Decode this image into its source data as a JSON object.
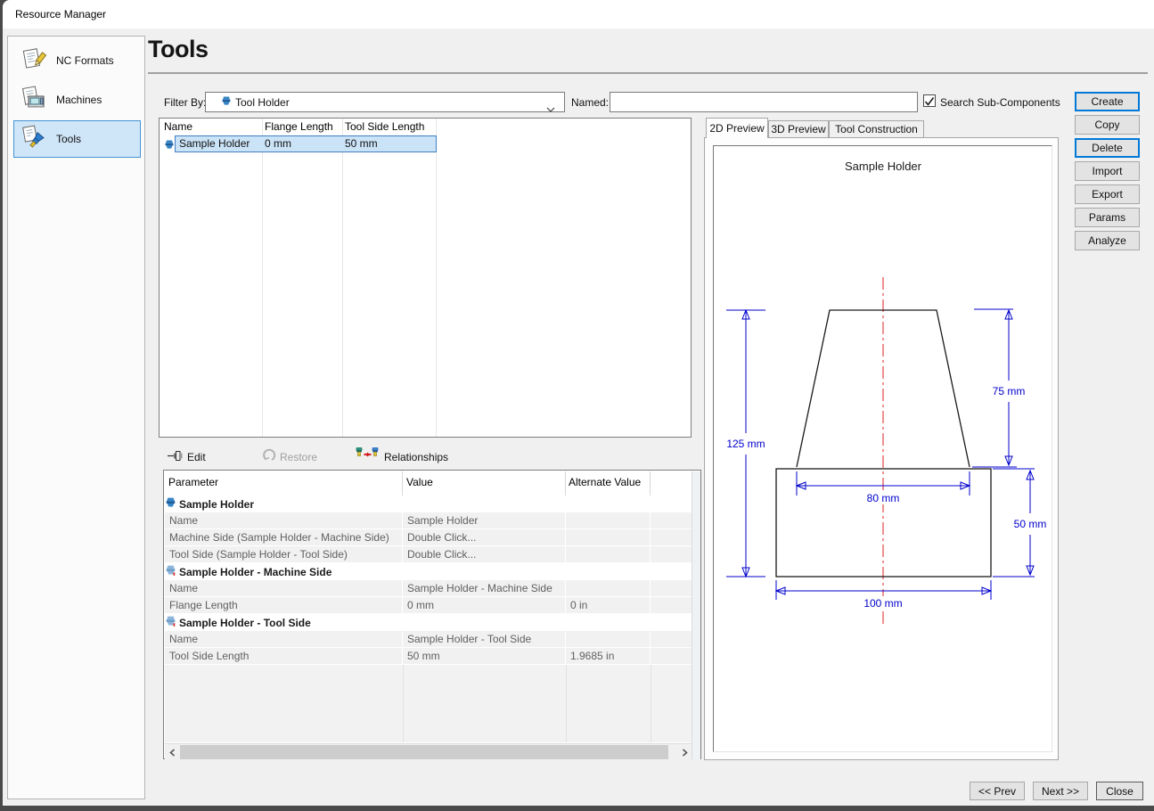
{
  "window": {
    "title": "Resource Manager"
  },
  "sidebar": {
    "items": [
      {
        "label": "NC Formats",
        "selected": false
      },
      {
        "label": "Machines",
        "selected": false
      },
      {
        "label": "Tools",
        "selected": true
      }
    ]
  },
  "header": {
    "title": "Tools"
  },
  "filter": {
    "label": "Filter By:",
    "selected": "Tool Holder",
    "named_label": "Named:",
    "named_value": "",
    "search_sub_label": "Search Sub-Components",
    "search_sub_checked": true
  },
  "actions": {
    "buttons": [
      "Create",
      "Copy",
      "Delete",
      "Import",
      "Export",
      "Params",
      "Analyze"
    ]
  },
  "list": {
    "columns": [
      "Name",
      "Flange Length",
      "Tool Side Length"
    ],
    "rows": [
      {
        "name": "Sample Holder",
        "flange_length": "0 mm",
        "tool_side_length": "50 mm",
        "selected": true
      }
    ]
  },
  "toolbar": {
    "edit_label": "Edit",
    "restore_label": "Restore",
    "relationships_label": "Relationships"
  },
  "params": {
    "columns": [
      "Parameter",
      "Value",
      "Alternate Value"
    ],
    "rows": [
      {
        "type": "group",
        "icon": "tool-holder-icon",
        "label": "Sample Holder"
      },
      {
        "type": "data",
        "param": "Name",
        "value": "Sample Holder",
        "alt": ""
      },
      {
        "type": "data",
        "param": "Machine Side (Sample Holder - Machine Side)",
        "value": "Double Click...",
        "alt": ""
      },
      {
        "type": "data",
        "param": "Tool Side (Sample Holder - Tool Side)",
        "value": "Double Click...",
        "alt": ""
      },
      {
        "type": "group",
        "icon": "tool-holder-sub-icon",
        "label": "Sample Holder - Machine Side"
      },
      {
        "type": "data",
        "param": "Name",
        "value": "Sample Holder - Machine Side",
        "alt": ""
      },
      {
        "type": "data",
        "param": "Flange Length",
        "value": "0 mm",
        "alt": "0 in"
      },
      {
        "type": "group",
        "icon": "tool-holder-sub-icon",
        "label": "Sample Holder - Tool Side"
      },
      {
        "type": "data",
        "param": "Name",
        "value": "Sample Holder - Tool Side",
        "alt": ""
      },
      {
        "type": "data",
        "param": "Tool Side Length",
        "value": "50 mm",
        "alt": "1.9685 in"
      }
    ]
  },
  "preview": {
    "tabs": [
      "2D Preview",
      "3D Preview",
      "Tool Construction"
    ],
    "active_tab": "2D Preview",
    "title": "Sample Holder",
    "dims": {
      "total": "125 mm",
      "machine": "75 mm",
      "flange": "80 mm",
      "tool": "50 mm",
      "base": "100 mm"
    }
  },
  "footer": {
    "buttons": [
      "<< Prev",
      "Next >>",
      "Close"
    ]
  },
  "colors": {
    "accent": "#0078d7",
    "selection_fill": "#cbe3f7",
    "selection_border": "#3f7fc1",
    "dimension_blue": "#0000cc",
    "centerline_red": "#dd2222",
    "dialog_bg": "#f0f0f0"
  }
}
